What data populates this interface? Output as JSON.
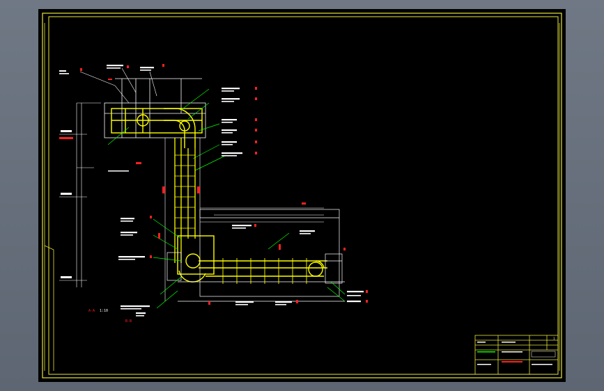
{
  "drawing": {
    "background": "#000000",
    "frame_color": "#e6e63c",
    "main_color": "#ffff00",
    "aux_color": "#ffffff",
    "callout_color": "#00ff00",
    "dimension_color": "#ff2020"
  },
  "labels": {
    "section_a": "A-A",
    "section_b": "B-B",
    "scale_note": "1:10",
    "title_block_no": "1"
  }
}
